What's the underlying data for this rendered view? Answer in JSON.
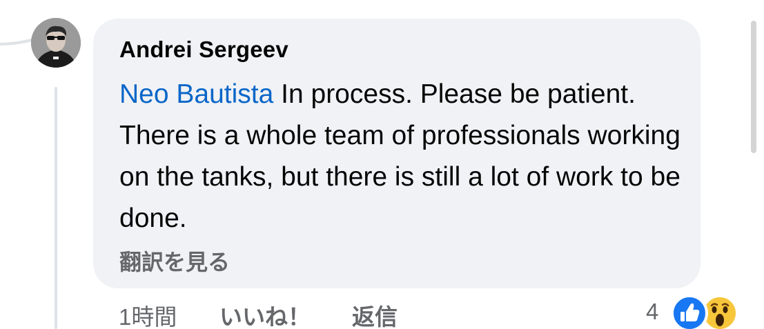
{
  "comment": {
    "author": "Andrei Sergeev",
    "mention": "Neo Bautista",
    "body": " In process. Please be patient. There is a whole team of professionals working on the tanks, but there is still a lot of work to be done.",
    "translate_label": "翻訳を見る"
  },
  "meta": {
    "time": "1時間",
    "like_label": "いいね！",
    "reply_label": "返信",
    "reaction_count": "4"
  },
  "reactions": [
    "like-icon",
    "wow-icon"
  ],
  "colors": {
    "bubble": "#f0f2f5",
    "mention": "#0a66c8",
    "meta_text": "#65676b",
    "like_blue": "#1877f2",
    "wow_yellow": "#f7c63b"
  }
}
